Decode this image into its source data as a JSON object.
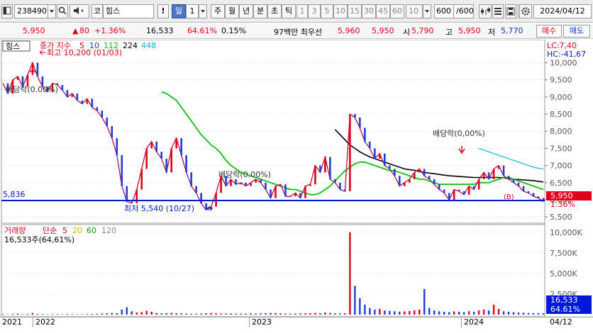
{
  "toolbar": {
    "code": "238490",
    "market_tag": "코",
    "stock_name": "힘스",
    "alert": "!",
    "period_selected": "일",
    "period_count": "1",
    "periods": [
      "주",
      "월",
      "년",
      "분",
      "초",
      "틱"
    ],
    "minutes": [
      "1",
      "3",
      "5",
      "10",
      "15",
      "30",
      "45",
      "60"
    ],
    "minute_custom": "10",
    "bar_count": "600",
    "bar_total": "/600",
    "date": "2024/04/12"
  },
  "quote": {
    "price": "5,950",
    "change": "80",
    "change_pct": "+1.36%",
    "volume": "16,533",
    "volume_ratio": "64.61%",
    "turnover": "0.15%",
    "amount_label": "97백만 최우선",
    "best_ask": "5,960",
    "best_bid": "5,950",
    "open_label": "시",
    "open": "5,790",
    "high_label": "고",
    "high": "5,950",
    "low_label": "저",
    "low": "5,770",
    "buy_button": "매수",
    "sell_button": "매도"
  },
  "chart": {
    "title_box": "힘스",
    "legend_label": "종가 지수",
    "ma_periods": [
      "5",
      "10",
      "112",
      "224",
      "448"
    ],
    "ma_colors": [
      "#e0001b",
      "#1f3fd4",
      "#12c012",
      "#000000",
      "#19b7d6"
    ],
    "lc_label": "LC:7,40",
    "hc_label": "HC:-41,67",
    "max_label": "최고 10,200 (01/03)",
    "min_label": "최저 5,540 (10/27)",
    "dividend_labels": [
      "배당락(0.00%)",
      "배당락(0.00%)",
      "배당락(0,00%)"
    ],
    "support_label": "5,836",
    "current_price_badge": "5,950",
    "current_pct_badge": "1.36%",
    "b_marker": "(B)",
    "y_ticks": [
      "10,000",
      "9,500",
      "9,000",
      "8,500",
      "8,000",
      "7,500",
      "7,000",
      "6,500",
      "6,000",
      "5,500"
    ],
    "volume_title": "거래량",
    "volume_ma_label": "단순",
    "volume_ma_periods": [
      "5",
      "20",
      "60",
      "120"
    ],
    "volume_ma_colors": [
      "#e0001b",
      "#d9b800",
      "#12a012",
      "#8a8a8a"
    ],
    "volume_sub": "16,533주(64,61%)",
    "volume_ticks": [
      "10,000K",
      "7,500K",
      "5,000K",
      "2,500K"
    ],
    "volume_badge": "16,533",
    "volume_pct_badge": "64.61%"
  },
  "chart_data": {
    "type": "line",
    "price": {
      "ylim": [
        5400,
        10300
      ],
      "close": [
        9400,
        9100,
        9500,
        9600,
        9300,
        9650,
        10000,
        9600,
        9300,
        9150,
        9400,
        9350,
        9200,
        9000,
        9100,
        8900,
        8800,
        8950,
        8700,
        8600,
        8400,
        8150,
        7800,
        7300,
        6400,
        5950,
        5900,
        6300,
        6900,
        7500,
        7700,
        7400,
        7200,
        6800,
        7500,
        7800,
        7300,
        6800,
        6400,
        6200,
        5900,
        5700,
        5800,
        6200,
        6700,
        6400,
        6600,
        6450,
        6500,
        6400,
        6500,
        6600,
        6500,
        6300,
        6050,
        6400,
        6450,
        6100,
        6100,
        6200,
        6050,
        6400,
        6450,
        7000,
        6800,
        7250,
        6600,
        6500,
        6300,
        6250,
        8500,
        8400,
        8100,
        7700,
        7500,
        7200,
        7350,
        7000,
        6900,
        6700,
        6400,
        6500,
        6600,
        6800,
        6900,
        6700,
        6600,
        6450,
        6300,
        6200,
        6000,
        6300,
        6250,
        6150,
        6400,
        6300,
        6600,
        6800,
        6600,
        6900,
        7000,
        6700,
        6600,
        6500,
        6400,
        6250,
        6200,
        6100,
        6050,
        5950
      ],
      "ma112": [
        null,
        null,
        null,
        null,
        null,
        null,
        null,
        null,
        null,
        null,
        null,
        null,
        null,
        null,
        null,
        null,
        null,
        null,
        null,
        null,
        null,
        null,
        null,
        null,
        null,
        null,
        null,
        null,
        null,
        null,
        null,
        null,
        9150,
        9100,
        9000,
        8900,
        8700,
        8500,
        8300,
        8100,
        7900,
        7750,
        7600,
        7500,
        7350,
        7150,
        7000,
        6900,
        6800,
        6750,
        6700,
        6650,
        6600,
        6550,
        6500,
        6450,
        6400,
        6350,
        6300,
        6300,
        6250,
        6200,
        6150,
        6150,
        6200,
        6300,
        6400,
        6550,
        6700,
        6850,
        6950,
        7050,
        7100,
        7100,
        7050,
        7000,
        6950,
        6900,
        6850,
        6850,
        6800,
        6750,
        6700,
        6650,
        6600,
        6600,
        6550,
        6500,
        6450,
        6450,
        6450,
        6450,
        6450,
        6450,
        6450,
        6450,
        6500,
        6500,
        6500,
        6550,
        6600,
        6650,
        6650,
        6600,
        6550,
        6500,
        6450,
        6400,
        6350,
        6300
      ],
      "ma224": [
        null,
        null,
        null,
        null,
        null,
        null,
        null,
        null,
        null,
        null,
        null,
        null,
        null,
        null,
        null,
        null,
        null,
        null,
        null,
        null,
        null,
        null,
        null,
        null,
        null,
        null,
        null,
        null,
        null,
        null,
        null,
        null,
        null,
        null,
        null,
        null,
        null,
        null,
        null,
        null,
        null,
        null,
        null,
        null,
        null,
        null,
        null,
        null,
        null,
        null,
        null,
        null,
        null,
        null,
        null,
        null,
        null,
        null,
        null,
        null,
        null,
        null,
        null,
        null,
        null,
        null,
        null,
        8050,
        7900,
        7750,
        7600,
        7500,
        7400,
        7320,
        7250,
        7200,
        7150,
        7100,
        7050,
        7000,
        6950,
        6900,
        6880,
        6860,
        6830,
        6800,
        6780,
        6760,
        6740,
        6720,
        6700,
        6690,
        6680,
        6670,
        6660,
        6650,
        6650,
        6650,
        6650,
        6650,
        6650,
        6640,
        6620,
        6600,
        6590,
        6580,
        6570,
        6560,
        6540,
        6520
      ],
      "ma448": [
        null,
        null,
        null,
        null,
        null,
        null,
        null,
        null,
        null,
        null,
        null,
        null,
        null,
        null,
        null,
        null,
        null,
        null,
        null,
        null,
        null,
        null,
        null,
        null,
        null,
        null,
        null,
        null,
        null,
        null,
        null,
        null,
        null,
        null,
        null,
        null,
        null,
        null,
        null,
        null,
        null,
        null,
        null,
        null,
        null,
        null,
        null,
        null,
        null,
        null,
        null,
        null,
        null,
        null,
        null,
        null,
        null,
        null,
        null,
        null,
        null,
        null,
        null,
        null,
        null,
        null,
        null,
        null,
        null,
        null,
        null,
        null,
        null,
        null,
        null,
        null,
        null,
        null,
        null,
        null,
        null,
        null,
        null,
        null,
        null,
        null,
        null,
        null,
        null,
        null,
        null,
        null,
        null,
        null,
        null,
        null,
        7500,
        7450,
        7400,
        7350,
        7300,
        7250,
        7200,
        7150,
        7100,
        7050,
        7000,
        6950,
        6920,
        6900
      ]
    },
    "volume": {
      "ylim": [
        0,
        10500
      ],
      "values": [
        60,
        40,
        80,
        120,
        50,
        70,
        200,
        90,
        60,
        40,
        50,
        60,
        45,
        70,
        55,
        40,
        50,
        60,
        80,
        90,
        120,
        150,
        200,
        180,
        600,
        900,
        400,
        250,
        300,
        450,
        350,
        200,
        150,
        180,
        220,
        160,
        140,
        120,
        100,
        110,
        130,
        160,
        200,
        150,
        130,
        120,
        140,
        110,
        100,
        120,
        140,
        130,
        150,
        170,
        200,
        180,
        150,
        130,
        110,
        120,
        140,
        160,
        170,
        200,
        180,
        250,
        200,
        150,
        140,
        160,
        10000,
        3500,
        2000,
        1200,
        800,
        600,
        700,
        500,
        450,
        400,
        350,
        380,
        420,
        500,
        600,
        3100,
        800,
        500,
        400,
        350,
        300,
        380,
        350,
        300,
        400,
        350,
        500,
        600,
        500,
        1200,
        700,
        400,
        350,
        300,
        250,
        220,
        200,
        180,
        170,
        160
      ]
    }
  }
}
